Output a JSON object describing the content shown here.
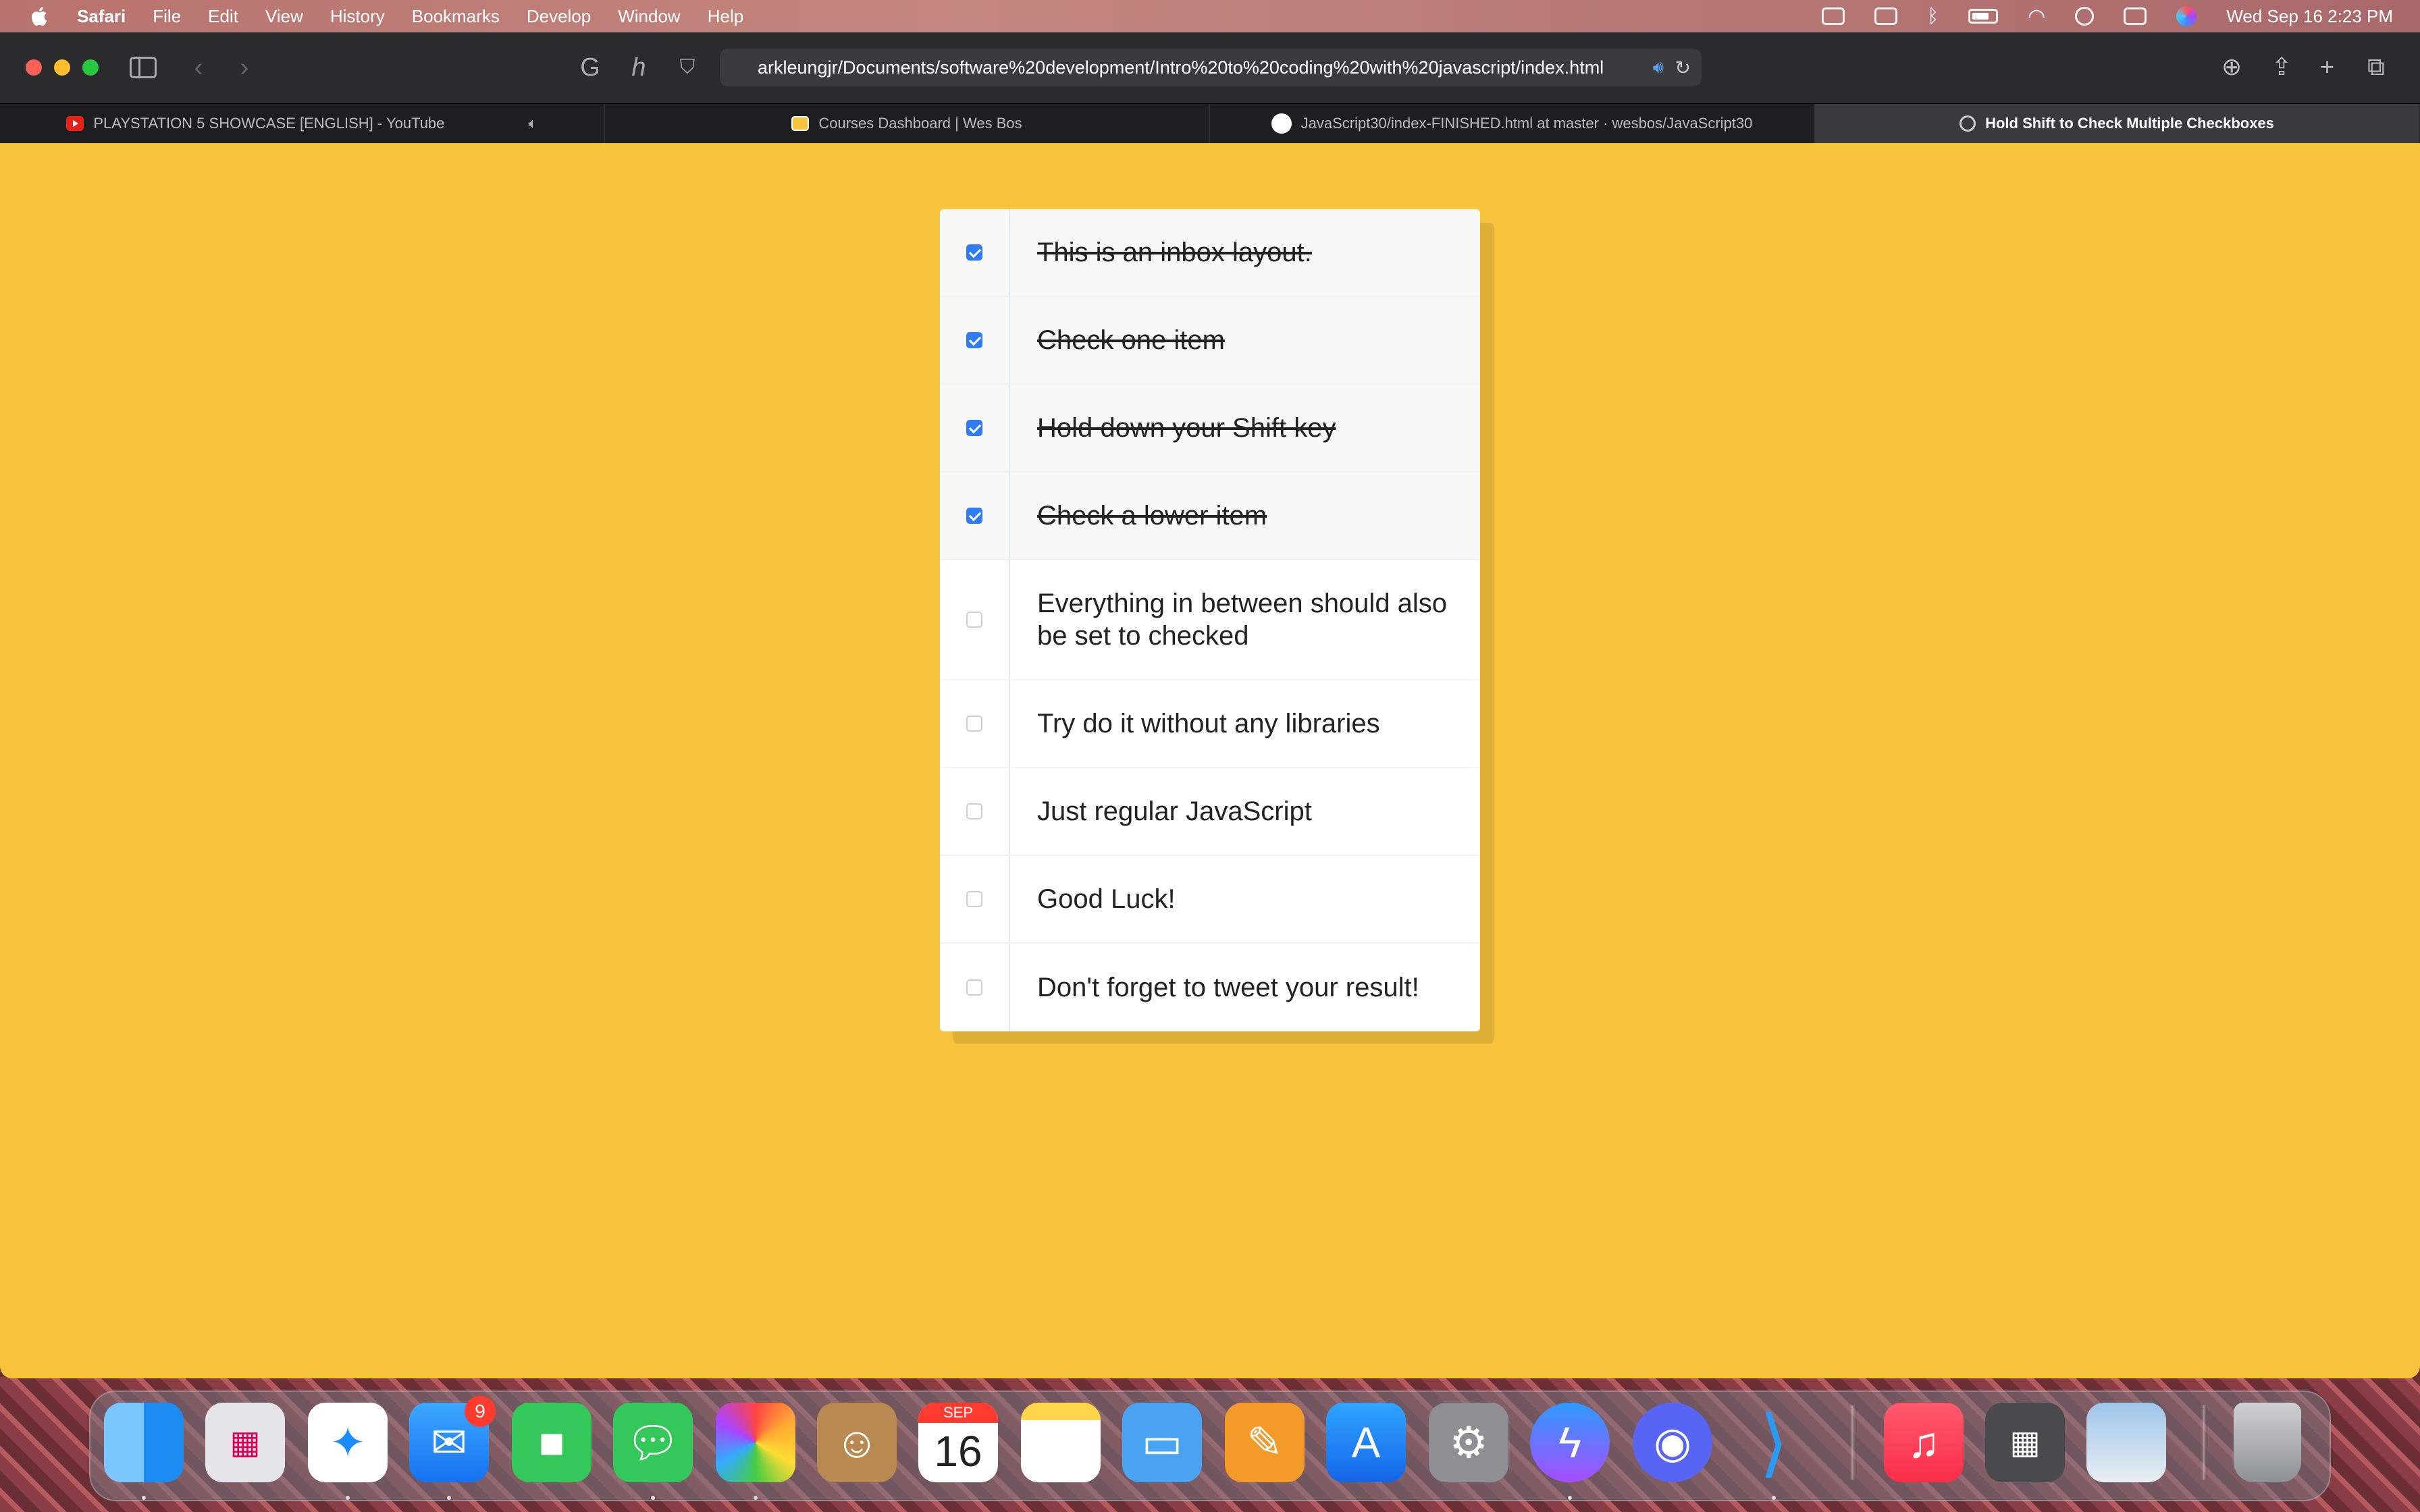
{
  "menubar": {
    "app_name": "Safari",
    "items": [
      "File",
      "Edit",
      "View",
      "History",
      "Bookmarks",
      "Develop",
      "Window",
      "Help"
    ],
    "clock": "Wed Sep 16  2:23 PM"
  },
  "browser": {
    "address": "arkleungjr/Documents/software%20development/Intro%20to%20coding%20with%20javascript/index.html",
    "tabs": [
      {
        "title": "PLAYSTATION 5 SHOWCASE [ENGLISH] - YouTube",
        "icon": "youtube-icon",
        "active": false
      },
      {
        "title": "Courses Dashboard | Wes Bos",
        "icon": "wesbos-icon",
        "active": false
      },
      {
        "title": "JavaScript30/index-FINISHED.html at master · wesbos/JavaScript30",
        "icon": "github-icon",
        "active": false
      },
      {
        "title": "Hold Shift to Check Multiple Checkboxes",
        "icon": "compass-icon",
        "active": true
      }
    ]
  },
  "inbox": {
    "items": [
      {
        "text": "This is an inbox layout.",
        "checked": true
      },
      {
        "text": "Check one item",
        "checked": true
      },
      {
        "text": "Hold down your Shift key",
        "checked": true
      },
      {
        "text": "Check a lower item",
        "checked": true
      },
      {
        "text": "Everything in between should also be set to checked",
        "checked": false
      },
      {
        "text": "Try do it without any libraries",
        "checked": false
      },
      {
        "text": "Just regular JavaScript",
        "checked": false
      },
      {
        "text": "Good Luck!",
        "checked": false
      },
      {
        "text": "Don't forget to tweet your result!",
        "checked": false
      }
    ]
  },
  "dock": {
    "mail_badge": "9",
    "calendar_month": "SEP",
    "calendar_day": "16",
    "apps": [
      "finder-icon",
      "launchpad-icon",
      "safari-icon",
      "mail-icon",
      "facetime-icon",
      "messages-icon",
      "photos-icon",
      "contacts-icon",
      "calendar-icon",
      "notes-icon",
      "keynote-icon",
      "pages-icon",
      "app-store-icon",
      "system-preferences-icon",
      "messenger-icon",
      "discord-icon",
      "vscode-icon",
      "music-icon",
      "calculator-icon",
      "preview-icon",
      "trash-icon"
    ]
  },
  "colors": {
    "page_background": "#f8c43e",
    "checkbox_checked": "#2f7cf6"
  }
}
